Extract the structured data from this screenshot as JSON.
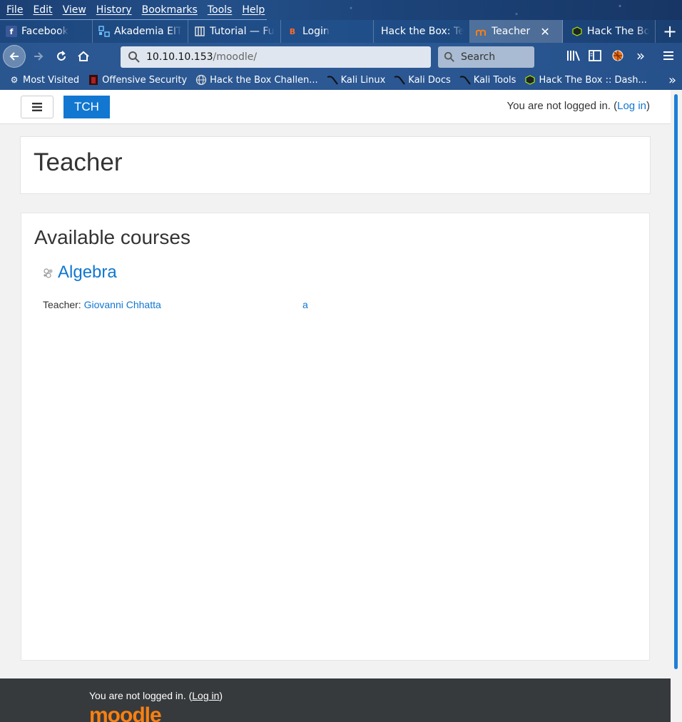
{
  "menubar": {
    "items": [
      "File",
      "Edit",
      "View",
      "History",
      "Bookmarks",
      "Tools",
      "Help"
    ]
  },
  "tabs": [
    {
      "label": "Facebook",
      "icon": "facebook-icon"
    },
    {
      "label": "Akademia EITC",
      "icon": "akademia-icon"
    },
    {
      "label": "Tutorial — Fuzz",
      "icon": "tutorial-icon"
    },
    {
      "label": "Login",
      "icon": "login-icon"
    },
    {
      "label": "Hack the Box: Teac",
      "icon": ""
    },
    {
      "label": "Teacher",
      "icon": "moodle-icon",
      "active": true
    },
    {
      "label": "Hack The Box",
      "icon": "htb-icon"
    }
  ],
  "navbar": {
    "url_host": "10.10.10.153",
    "url_path": "/moodle/",
    "search_placeholder": "Search"
  },
  "bookmarks": [
    {
      "label": "Most Visited",
      "icon": "gear-icon"
    },
    {
      "label": "Offensive Security",
      "icon": "offsec-icon"
    },
    {
      "label": "Hack the Box Challen...",
      "icon": "globe-icon"
    },
    {
      "label": "Kali Linux",
      "icon": "kali-icon"
    },
    {
      "label": "Kali Docs",
      "icon": "kali-icon"
    },
    {
      "label": "Kali Tools",
      "icon": "kali-icon"
    },
    {
      "label": "Hack The Box :: Dash...",
      "icon": "htb-icon"
    }
  ],
  "site": {
    "brand": "TCH",
    "login_prefix": "You are not logged in. (",
    "login_link": "Log in",
    "login_suffix": ")"
  },
  "page": {
    "title": "Teacher",
    "courses_heading": "Available courses",
    "course_name": "Algebra",
    "teacher_label": "Teacher: ",
    "teacher_name": "Giovanni Chhatta",
    "teacher_extra": "a"
  },
  "footer": {
    "login_prefix": "You are not logged in. (",
    "login_link": "Log in",
    "login_suffix": ")",
    "logo_text": "moodle"
  },
  "colors": {
    "link": "#1177d1",
    "brand_bg": "#1177d1",
    "footer_bg": "#373a3c",
    "moodle_orange": "#f98012"
  }
}
